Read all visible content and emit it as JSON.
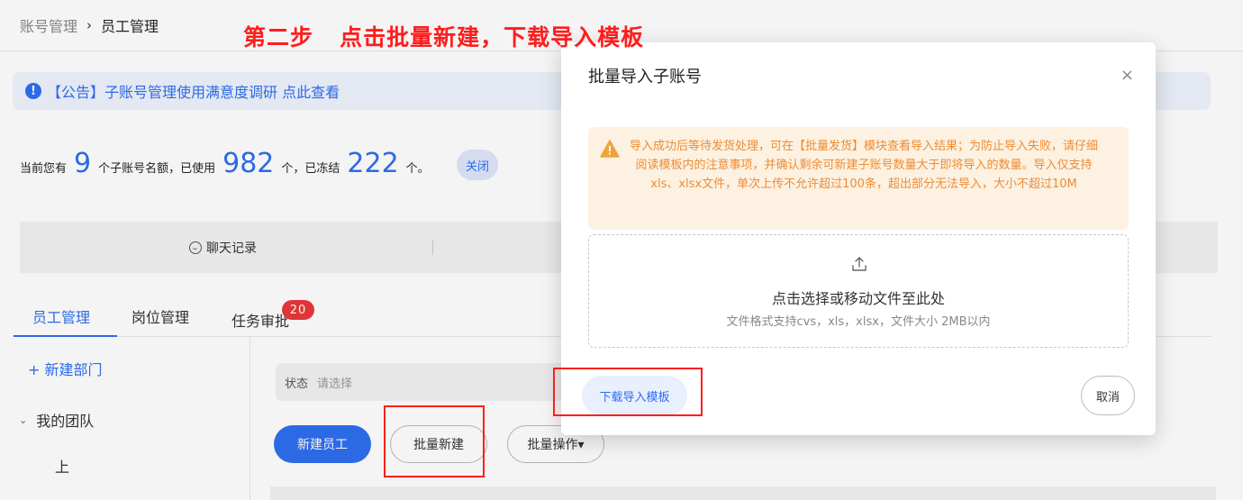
{
  "breadcrumb": {
    "parent": "账号管理",
    "separator": "›",
    "current": "员工管理"
  },
  "annotation": "第二步   点击批量新建，下载导入模板",
  "notice": {
    "icon": "info-icon",
    "text": "【公告】子账号管理使用满意度调研 点此查看"
  },
  "quota": {
    "prefix": "当前您有",
    "total": "9",
    "mid1": "个子账号名额，已使用",
    "used": "982",
    "mid2": "个，已冻结",
    "frozen": "222",
    "suffix": "个。",
    "close_label": "关闭"
  },
  "chatbar": {
    "chat_label": "聊天记录",
    "icon": "chat-icon"
  },
  "tabs": [
    {
      "label": "员工管理",
      "active": true
    },
    {
      "label": "岗位管理",
      "active": false
    },
    {
      "label": "任务审批",
      "active": false,
      "badge": "20"
    }
  ],
  "sidebar": {
    "add_dept": "+ 新建部门",
    "team": "我的团队",
    "team_child": "上"
  },
  "filter": {
    "label": "状态",
    "placeholder": "请选择"
  },
  "actions": {
    "new_employee": "新建员工",
    "batch_new": "批量新建",
    "batch_ops": "批量操作▾"
  },
  "modal": {
    "title": "批量导入子账号",
    "close": "×",
    "warning": "导入成功后等待发货处理，可在【批量发货】模块查看导入结果；为防止导入失败，请仔细阅读模板内的注意事项，并确认剩余可新建子账号数量大于即将导入的数量。导入仅支持xls、xlsx文件，单次上传不允许超过100条，超出部分无法导入，大小不超过10M",
    "upload_title": "点击选择或移动文件至此处",
    "upload_hint": "文件格式支持cvs，xls，xlsx，文件大小 2MB以内",
    "download_label": "下载导入模板",
    "cancel_label": "取消"
  },
  "colors": {
    "primary": "#2f6ff0",
    "warning_text": "#ec8d35",
    "warning_bg": "#fdf1e1",
    "annotation": "#ff1d1d",
    "badge": "#e8393b"
  }
}
